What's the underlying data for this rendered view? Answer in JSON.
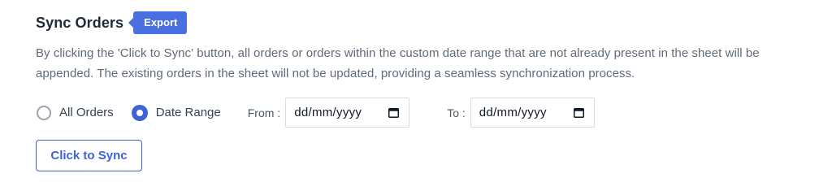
{
  "header": {
    "title": "Sync Orders",
    "badge": "Export"
  },
  "description": "By clicking the 'Click to Sync' button, all orders or orders within the custom date range that are not already present in the sheet will be appended. The existing orders in the sheet will not be updated, providing a seamless synchronization process.",
  "options": {
    "all_orders": {
      "label": "All Orders",
      "checked": false
    },
    "date_range": {
      "label": "Date Range",
      "checked": true
    }
  },
  "date_from": {
    "label": "From :",
    "value": "dd/mm/yyyy"
  },
  "date_to": {
    "label": "To :",
    "value": "dd/mm/yyyy"
  },
  "sync_button": {
    "label": "Click to Sync"
  },
  "colors": {
    "accent": "#3f62d8",
    "badge": "#4a6fe0",
    "text": "#1f2937",
    "muted": "#5f6b7a"
  },
  "icons": {
    "calendar": "calendar-icon"
  }
}
